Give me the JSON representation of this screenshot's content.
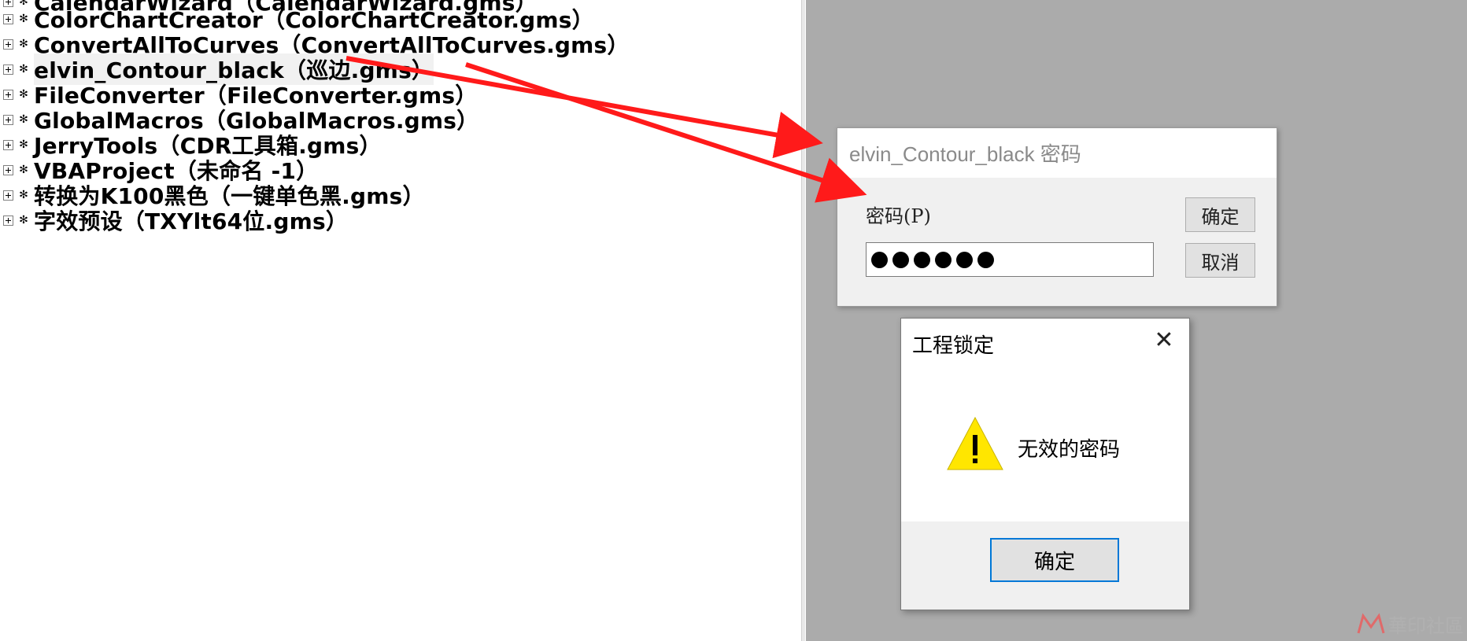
{
  "tree": {
    "partial_top_label": "CalendarWizard（CalendarWizard.gms）",
    "items": [
      {
        "label": "ColorChartCreator（ColorChartCreator.gms）"
      },
      {
        "label": "ConvertAllToCurves（ConvertAllToCurves.gms）"
      },
      {
        "label": "elvin_Contour_black（巡边.gms）",
        "selected": true
      },
      {
        "label": "FileConverter（FileConverter.gms）"
      },
      {
        "label": "GlobalMacros（GlobalMacros.gms）"
      },
      {
        "label": "JerryTools（CDR工具箱.gms）"
      },
      {
        "label": "VBAProject（未命名 -1）"
      },
      {
        "label": "转换为K100黑色（一键单色黑.gms）"
      },
      {
        "label": "字效预设（TXYlt64位.gms）"
      }
    ],
    "node_icon": "gear-icon"
  },
  "password_dialog": {
    "title": "elvin_Contour_black 密码",
    "label": "密码(P)",
    "masked_length": 6,
    "ok_label": "确定",
    "cancel_label": "取消"
  },
  "error_dialog": {
    "title": "工程锁定",
    "close_glyph": "✕",
    "message": "无效的密码",
    "ok_label": "确定",
    "icon": "warning-icon"
  },
  "annotation": {
    "arrow_color": "#ff1a1a"
  },
  "watermark": {
    "text": "華印社區"
  }
}
